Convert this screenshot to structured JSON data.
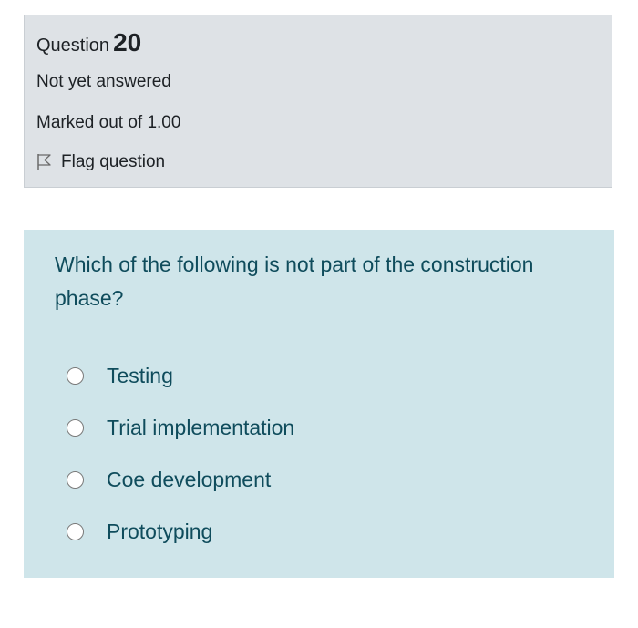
{
  "info": {
    "question_label": "Question",
    "question_number": "20",
    "state": "Not yet answered",
    "grade": "Marked out of 1.00",
    "flag_label": "Flag question"
  },
  "content": {
    "question_text": "Which of the following is not part of the construction phase?",
    "options": [
      {
        "label": "Testing"
      },
      {
        "label": "Trial implementation"
      },
      {
        "label": "Coe development"
      },
      {
        "label": "Prototyping"
      }
    ]
  },
  "colors": {
    "info_bg": "#dee2e6",
    "content_bg": "#cfe5ea",
    "text_dark": "#1d2125",
    "text_teal": "#0f4c5c"
  }
}
